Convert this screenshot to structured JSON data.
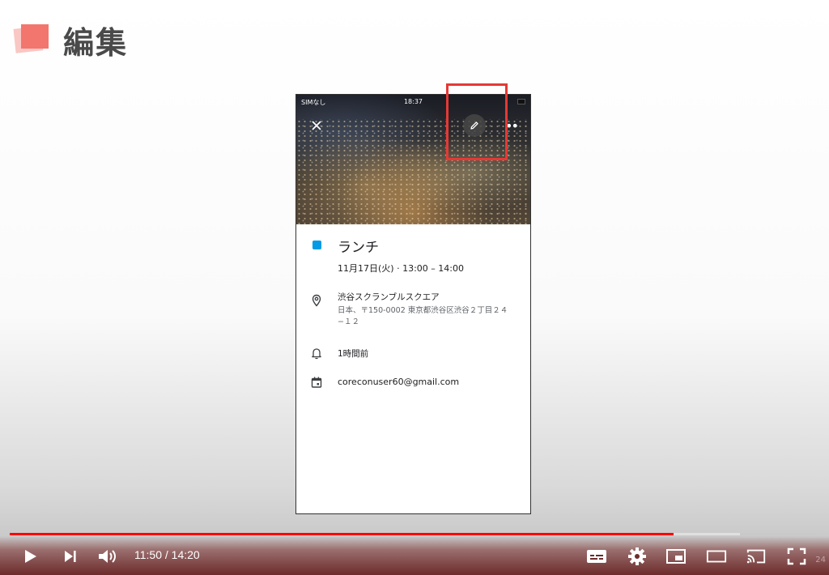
{
  "slide": {
    "title": "編集"
  },
  "phone": {
    "status": {
      "carrier": "SIMなし",
      "time": "18:37"
    },
    "header": {
      "more_label": "••"
    },
    "event": {
      "title": "ランチ",
      "datetime": "11月17日(火) · 13:00 – 14:00",
      "location_name": "渋谷スクランブルスクエア",
      "location_address": "日本、〒150-0002 東京都渋谷区渋谷２丁目２４−１２",
      "reminder": "1時間前",
      "account": "coreconuser60@gmail.com",
      "color": "#039be5"
    }
  },
  "player": {
    "current_time": "11:50",
    "separator": " / ",
    "duration": "14:20",
    "corner_label": "24",
    "progress_played": 0.823,
    "progress_buffered": 0.906,
    "accent": "#ff0000"
  }
}
